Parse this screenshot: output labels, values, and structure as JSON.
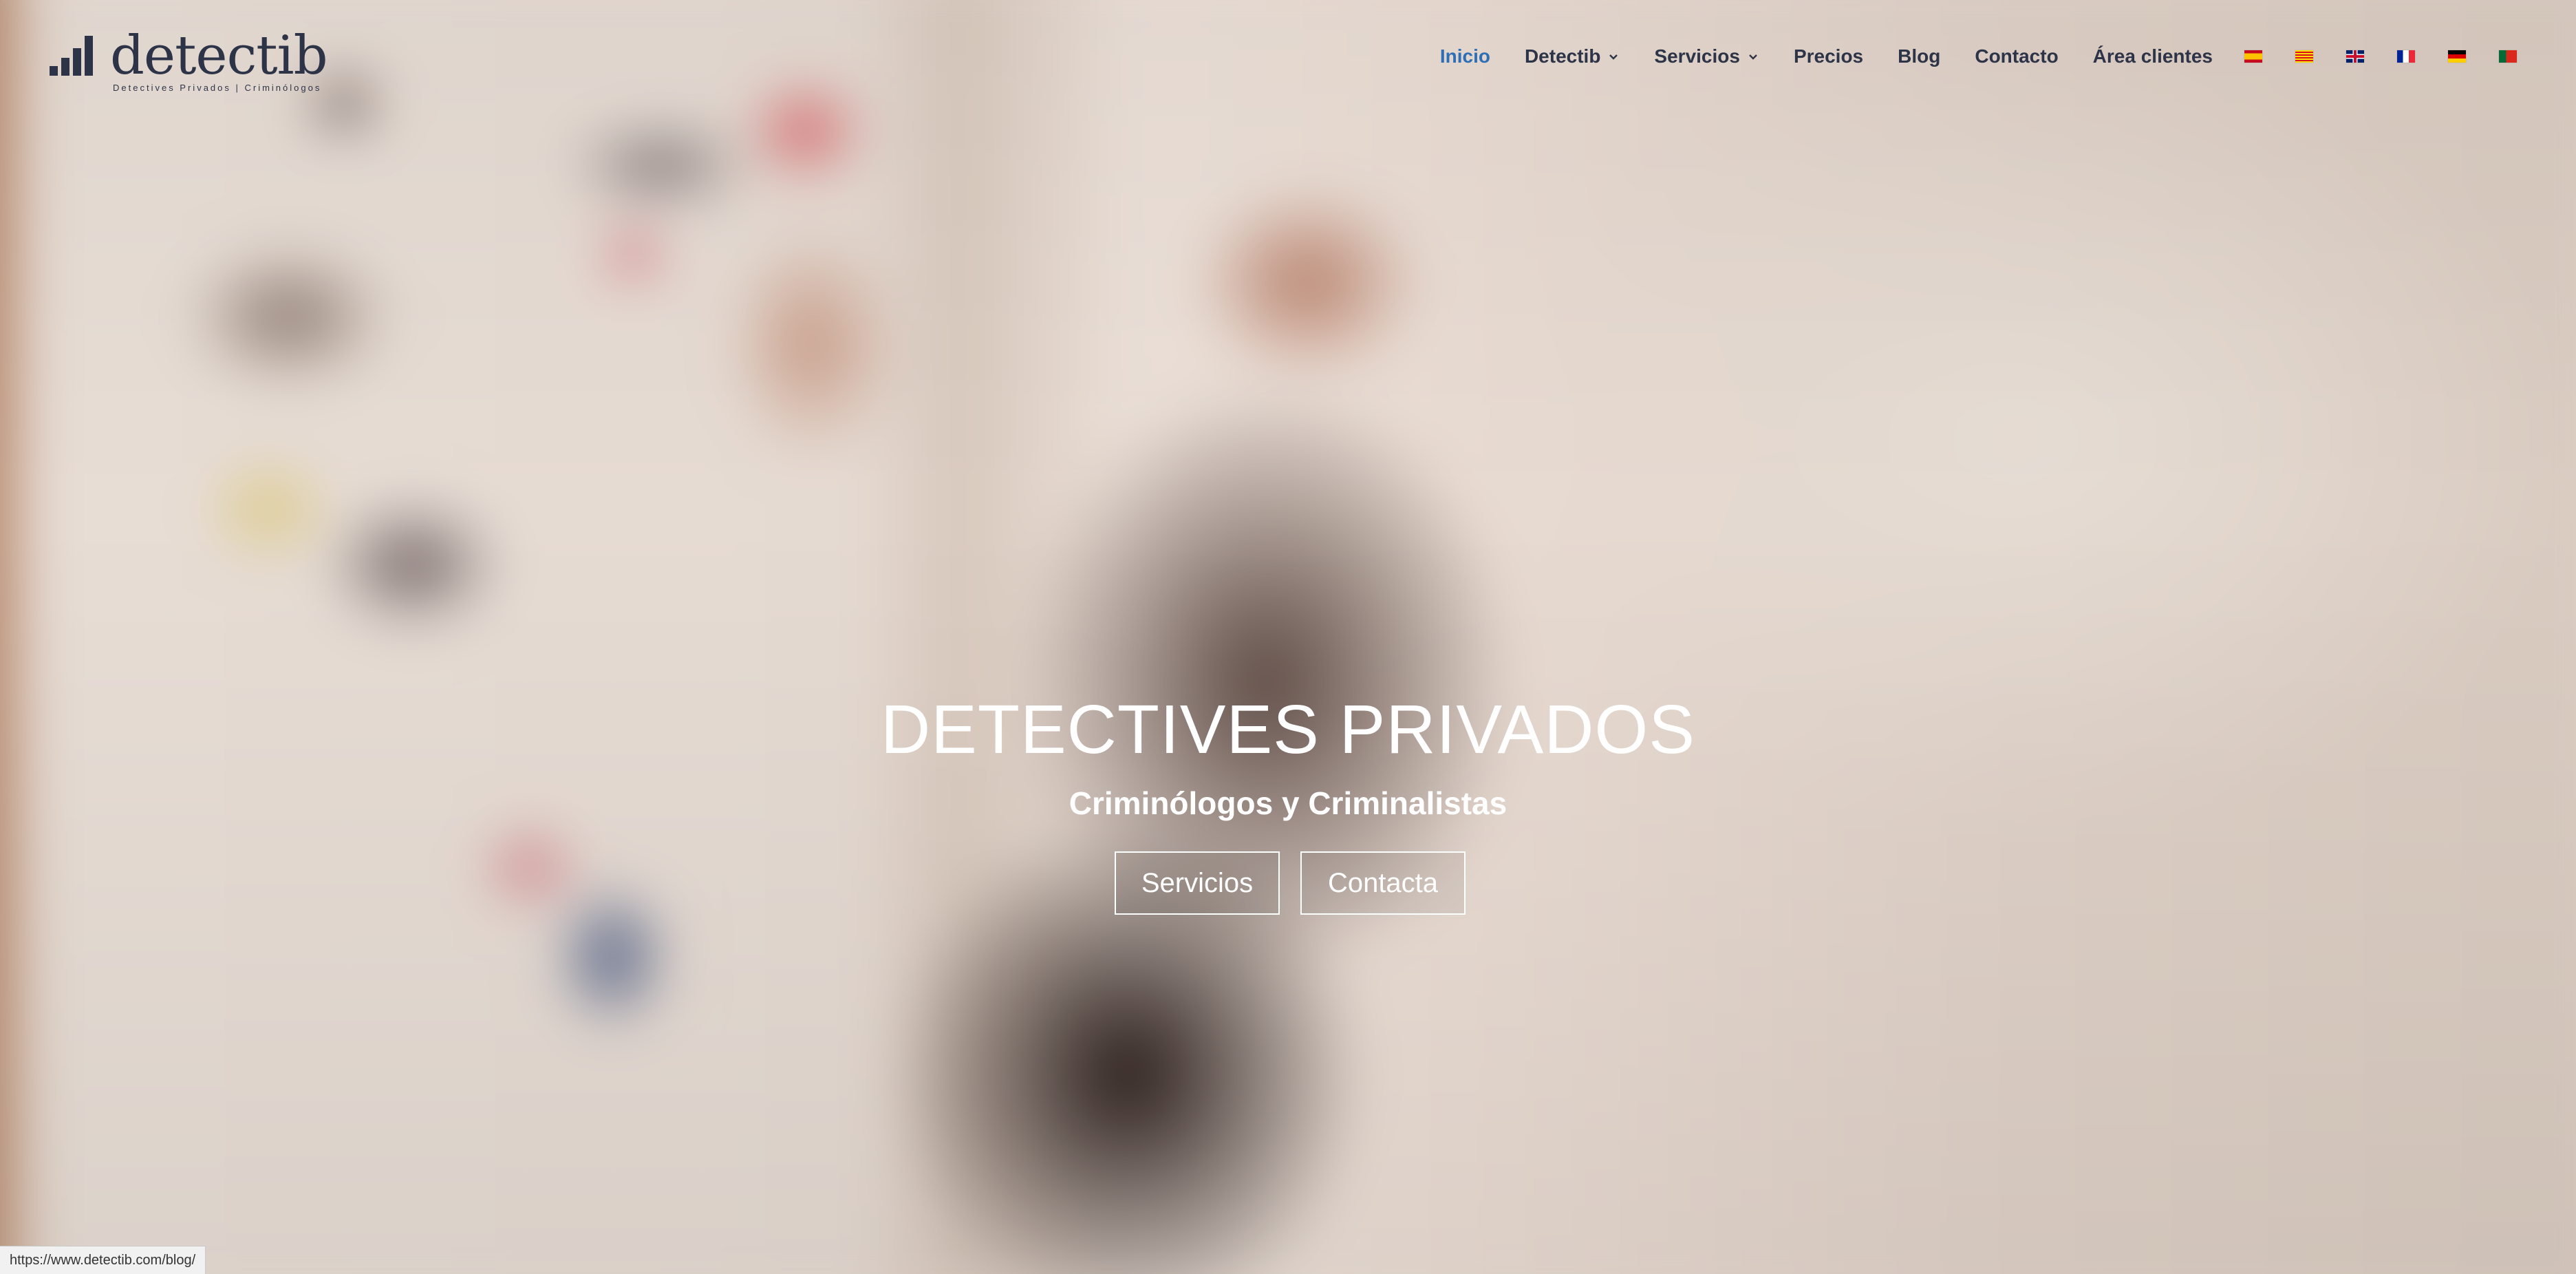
{
  "logo": {
    "name": "detectib",
    "tagline": "Detectives Privados | Criminólogos"
  },
  "nav": {
    "items": [
      {
        "label": "Inicio",
        "active": true
      },
      {
        "label": "Detectib",
        "has_dropdown": true
      },
      {
        "label": "Servicios",
        "has_dropdown": true
      },
      {
        "label": "Precios"
      },
      {
        "label": "Blog"
      },
      {
        "label": "Contacto"
      },
      {
        "label": "Área clientes"
      }
    ],
    "flags": [
      "es",
      "ca",
      "gb",
      "fr",
      "de",
      "pt"
    ]
  },
  "hero": {
    "title": "DETECTIVES PRIVADOS",
    "subtitle": "Criminólogos y Criminalistas",
    "buttons": [
      "Servicios",
      "Contacta"
    ]
  },
  "status_bar": {
    "url": "https://www.detectib.com/blog/"
  },
  "colors": {
    "nav_text": "#2e3448",
    "nav_active": "#2d6fb7"
  }
}
